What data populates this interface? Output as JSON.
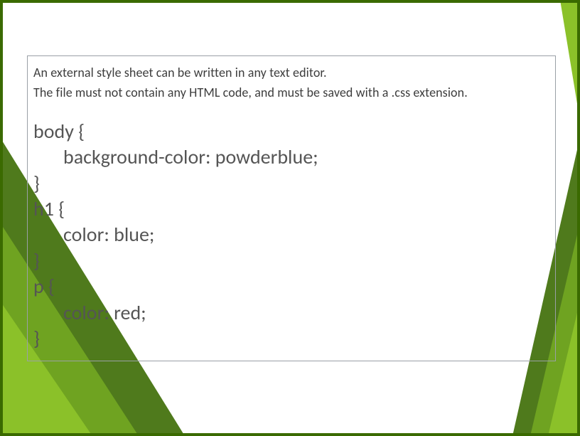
{
  "intro": {
    "line1": "An external style sheet can be written in any text editor.",
    "line2": "The file must not contain any HTML code, and must be saved with a .css extension."
  },
  "code": {
    "l1": "body {",
    "l2": "background-color: powderblue;",
    "l3": "}",
    "l4": "h1 {",
    "l5": "color: blue;",
    "l6": "}",
    "l7": "p {",
    "l8": "color: red;",
    "l9": "}"
  }
}
